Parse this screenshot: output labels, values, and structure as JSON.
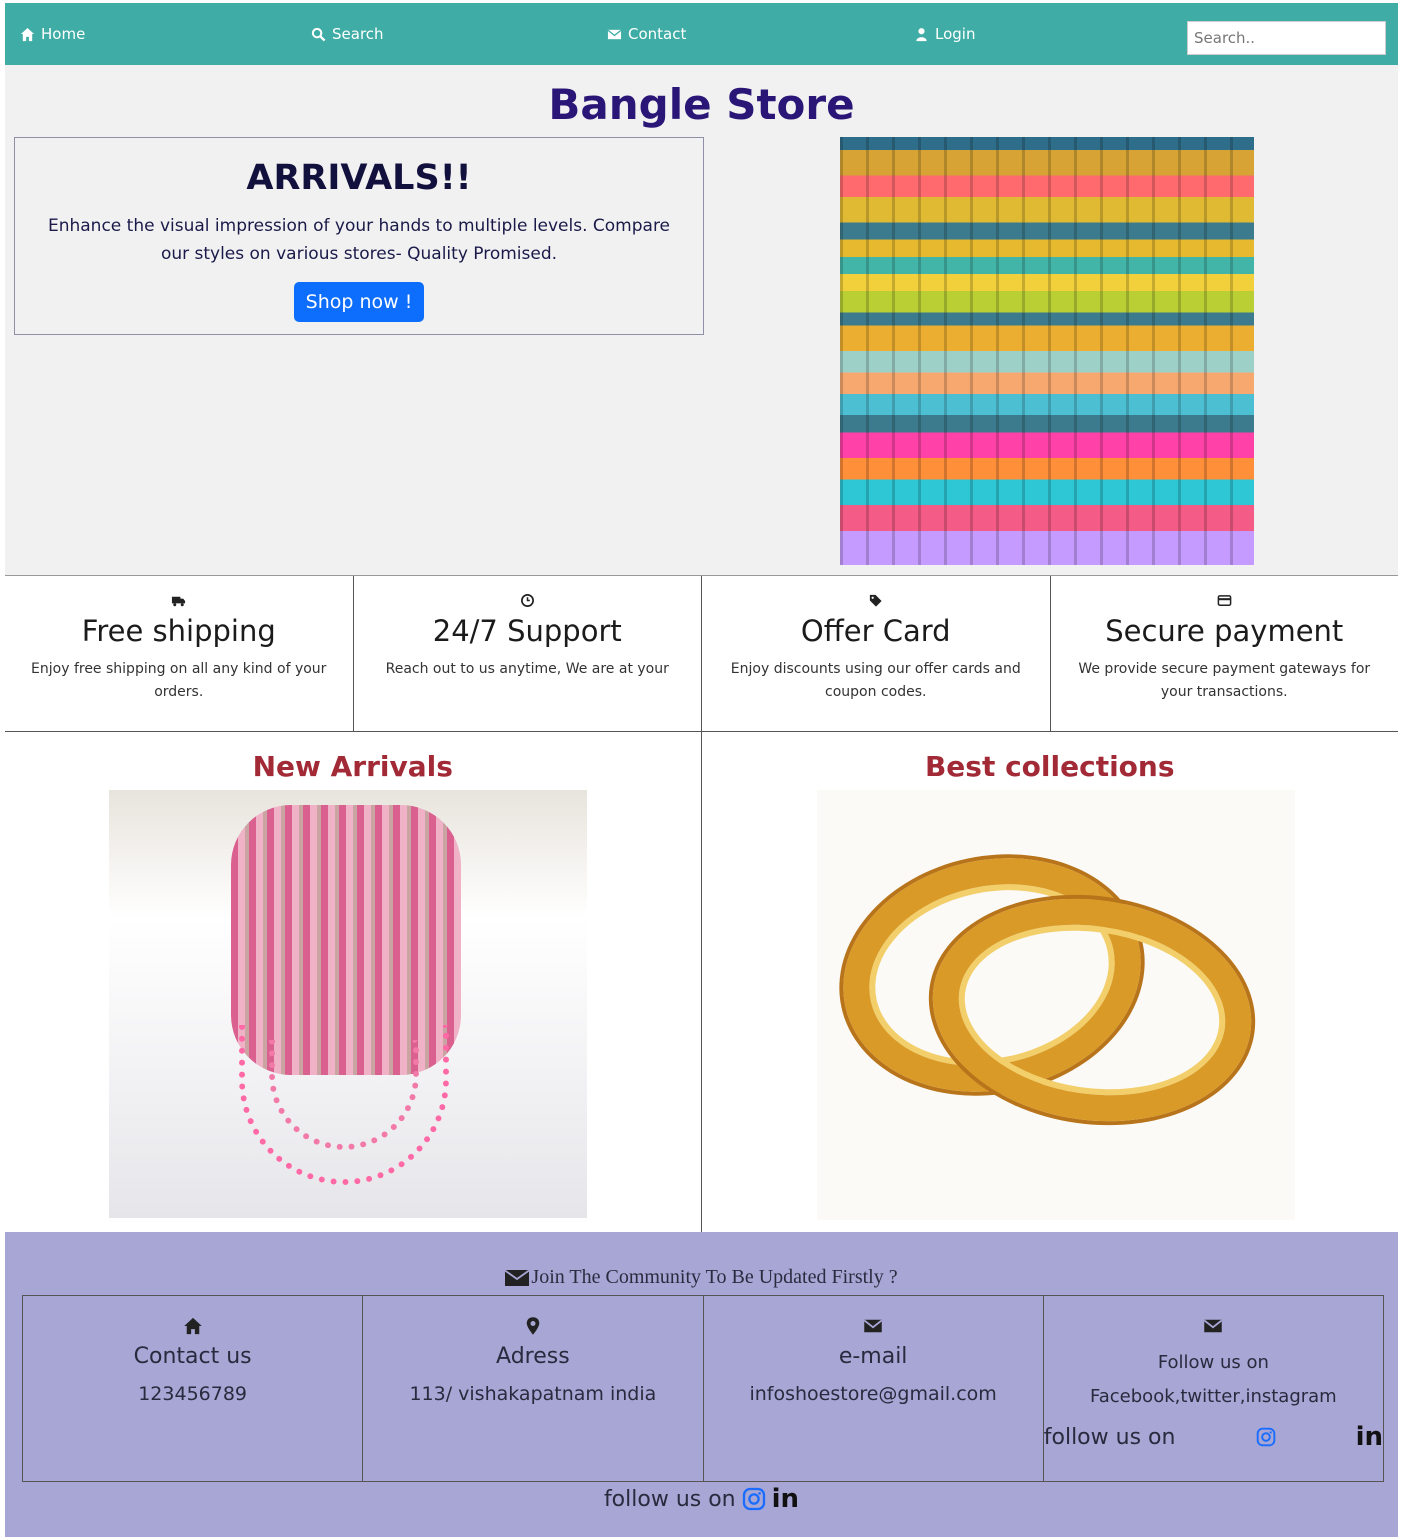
{
  "nav": {
    "items": [
      {
        "label": "Home",
        "icon": "home-icon"
      },
      {
        "label": "Search",
        "icon": "search-icon"
      },
      {
        "label": "Contact",
        "icon": "envelope-icon"
      },
      {
        "label": "Login",
        "icon": "user-icon"
      }
    ],
    "search_placeholder": "Search..",
    "bg_color": "#3fada5"
  },
  "hero": {
    "title": "Bangle Store",
    "arrivals_heading": "ARRIVALS!!",
    "arrivals_text": "Enhance the visual impression of your hands to multiple levels. Compare our styles on various stores- Quality Promised.",
    "shop_button": "Shop now !"
  },
  "features": [
    {
      "icon": "truck-icon",
      "title": "Free shipping",
      "text": "Enjoy free shipping on all any kind of your orders."
    },
    {
      "icon": "clock-icon",
      "title": "24/7 Support",
      "text": "Reach out to us anytime, We are at your"
    },
    {
      "icon": "tag-icon",
      "title": "Offer Card",
      "text": "Enjoy discounts using our offer cards and coupon codes."
    },
    {
      "icon": "credit-card-icon",
      "title": "Secure payment",
      "text": "We provide secure payment gateways for your transactions."
    }
  ],
  "collections": {
    "new_title": "New Arrivals",
    "best_title": "Best collections"
  },
  "footer": {
    "join_text": "Join The Community To Be Updated Firstly ?",
    "cells": [
      {
        "icon": "home-icon",
        "title": "Contact us",
        "value": "123456789"
      },
      {
        "icon": "map-pin-icon",
        "title": "Adress",
        "value": "113/ vishakapatnam india"
      },
      {
        "icon": "envelope-icon",
        "title": "e-mail",
        "value": "infoshoestore@gmail.com"
      },
      {
        "icon": "envelope-icon",
        "title": "Follow us on",
        "value": "Facebook,twitter,instagram",
        "follow": "follow us on"
      }
    ],
    "bottom_follow": "follow us on",
    "bg_color": "#a7a6d5"
  }
}
